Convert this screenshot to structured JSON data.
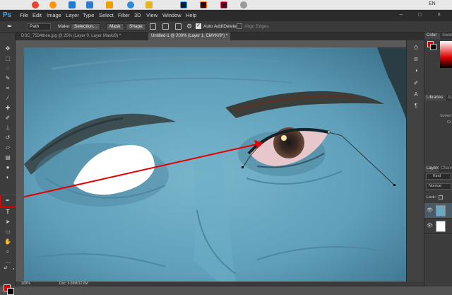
{
  "colors": {
    "accent_red": "#e60000",
    "skin_blue": "#6aa8c0",
    "panel_dark": "#3c3c3c"
  },
  "taskbar": {
    "lang": "EN",
    "icons": [
      "chrome-icon",
      "firefox-icon",
      "edge-icon",
      "media-player-icon",
      "cloud-icon",
      "explorer-icon",
      "folder-icon",
      "photoshop-icon",
      "illustrator-icon",
      "indesign-icon",
      "misc-icon"
    ]
  },
  "menubar": {
    "logo": "Ps",
    "items": [
      "File",
      "Edit",
      "Image",
      "Layer",
      "Type",
      "Select",
      "Filter",
      "3D",
      "View",
      "Window",
      "Help"
    ],
    "window_controls": "– □ ×"
  },
  "options": {
    "tool_mode": "Path",
    "make_label": "Make:",
    "selection_btn": "Selection...",
    "mask_btn": "Mask",
    "shape_btn": "Shape",
    "auto_add_delete": "Auto Add/Delete",
    "align_edges": "Align Edges"
  },
  "tabs": [
    {
      "label": "DSC_7534thee.jpg @ 25% (Layer 0, Layer Mask/8) *",
      "active": false
    },
    {
      "label": "Untitled-1 @ 200% (Layer 1, CMYK/8*) *",
      "active": true
    }
  ],
  "status": {
    "zoom": "200%",
    "doc": "Doc: 6.89M/12.6M"
  },
  "panels": {
    "color_tab": "Color",
    "swatches_tab": "Swatch",
    "libraries_tab": "Libraries",
    "adjust_tab": "Adj",
    "lib_text_1": "Somet",
    "lib_text_2": "Cr",
    "layers_tab": "Layers",
    "channels_tab": "Chann",
    "kind_label": "Kind",
    "blend_mode": "Normal",
    "lock_label": "Lock:"
  }
}
